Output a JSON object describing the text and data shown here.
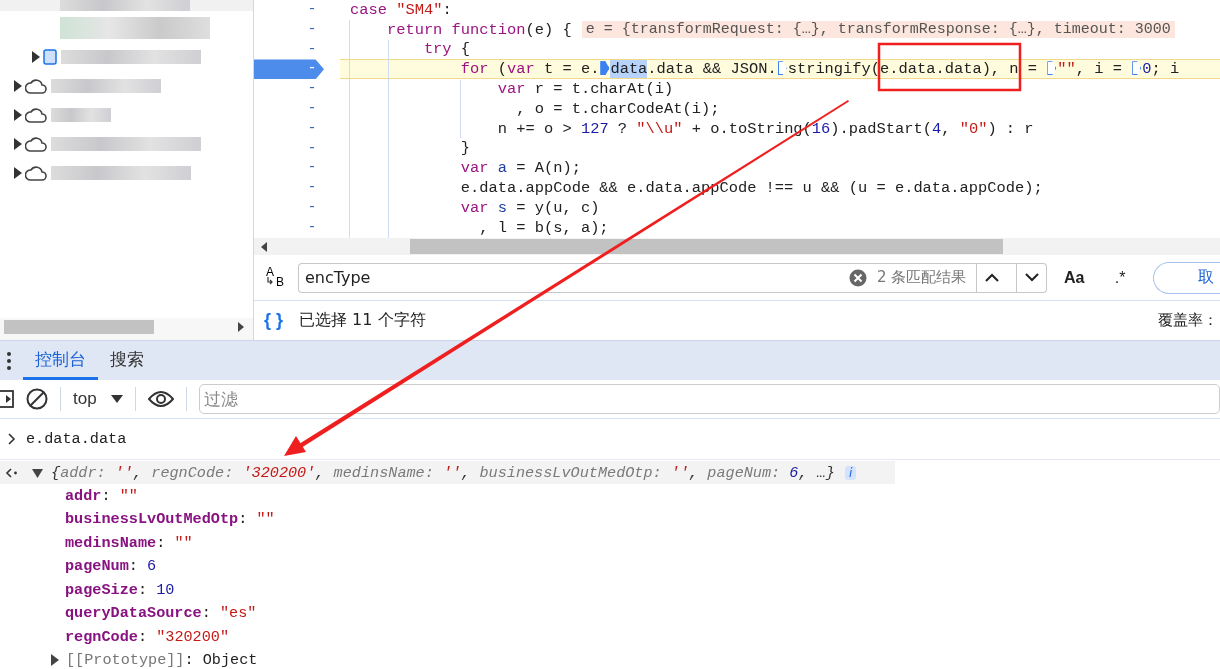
{
  "file_tree": {
    "items": [
      {
        "kind": "file",
        "expanded": false
      },
      {
        "kind": "cloud",
        "expanded": false
      },
      {
        "kind": "cloud",
        "expanded": false
      },
      {
        "kind": "cloud",
        "expanded": false
      },
      {
        "kind": "cloud",
        "expanded": false
      }
    ]
  },
  "editor": {
    "lines": [
      {
        "gutter": "-",
        "paused": false,
        "segments": [
          {
            "text": "case",
            "kind": "keyword"
          },
          {
            "text": " \"SM4\"",
            "kind": "string"
          },
          {
            "text": ":",
            "kind": "plain"
          }
        ]
      },
      {
        "gutter": "-",
        "paused": false,
        "segments": [
          {
            "text": "    return",
            "kind": "keyword"
          },
          {
            "text": " function",
            "kind": "keyword"
          },
          {
            "text": "(e) {",
            "kind": "plain"
          }
        ],
        "inline_value": "e = {transformRequest: {…}, transformResponse: {…}, timeout: 3000"
      },
      {
        "gutter": "-",
        "paused": false,
        "segments": [
          {
            "text": "        try",
            "kind": "keyword"
          },
          {
            "text": " {",
            "kind": "plain"
          }
        ]
      },
      {
        "gutter": "-",
        "paused": true,
        "segments": [
          {
            "text": "            for",
            "kind": "keyword"
          },
          {
            "text": " (",
            "kind": "plain"
          },
          {
            "text": "var",
            "kind": "keyword"
          },
          {
            "text": " t = e.",
            "kind": "plain"
          },
          {
            "kind": "marker",
            "active": true
          },
          {
            "text": "data",
            "kind": "selection"
          },
          {
            "text": ".data && JSON.",
            "kind": "plain"
          },
          {
            "kind": "marker",
            "active": false
          },
          {
            "text": "stringify(e.data.data), n = ",
            "kind": "plain"
          },
          {
            "kind": "marker",
            "active": false
          },
          {
            "text": "\"\"",
            "kind": "string"
          },
          {
            "text": ", i = ",
            "kind": "plain"
          },
          {
            "kind": "marker",
            "active": false
          },
          {
            "text": "0",
            "kind": "number"
          },
          {
            "text": "; i",
            "kind": "plain"
          }
        ]
      },
      {
        "gutter": "-",
        "paused": false,
        "segments": [
          {
            "text": "                var",
            "kind": "keyword"
          },
          {
            "text": " r = t.charAt(i)",
            "kind": "plain"
          }
        ]
      },
      {
        "gutter": "-",
        "paused": false,
        "segments": [
          {
            "text": "                  , o = t.charCodeAt(i);",
            "kind": "plain"
          }
        ]
      },
      {
        "gutter": "-",
        "paused": false,
        "segments": [
          {
            "text": "                n += o > ",
            "kind": "plain"
          },
          {
            "text": "127",
            "kind": "number"
          },
          {
            "text": " ? ",
            "kind": "plain"
          },
          {
            "text": "\"\\\\u\"",
            "kind": "string"
          },
          {
            "text": " + o.toString(",
            "kind": "plain"
          },
          {
            "text": "16",
            "kind": "number"
          },
          {
            "text": ").padStart(",
            "kind": "plain"
          },
          {
            "text": "4",
            "kind": "number"
          },
          {
            "text": ", ",
            "kind": "plain"
          },
          {
            "text": "\"0\"",
            "kind": "string"
          },
          {
            "text": ") : r",
            "kind": "plain"
          }
        ]
      },
      {
        "gutter": "-",
        "paused": false,
        "segments": [
          {
            "text": "            }",
            "kind": "plain"
          }
        ]
      },
      {
        "gutter": "-",
        "paused": false,
        "segments": [
          {
            "text": "            var",
            "kind": "keyword"
          },
          {
            "text": " a",
            "kind": "def"
          },
          {
            "text": " = A(n);",
            "kind": "plain"
          }
        ]
      },
      {
        "gutter": "-",
        "paused": false,
        "segments": [
          {
            "text": "            e.data.appCode && e.data.appCode !== u && (u = e.data.appCode);",
            "kind": "plain"
          }
        ]
      },
      {
        "gutter": "-",
        "paused": false,
        "segments": [
          {
            "text": "            var",
            "kind": "keyword"
          },
          {
            "text": " s",
            "kind": "def"
          },
          {
            "text": " = y(u, c)",
            "kind": "plain"
          }
        ]
      },
      {
        "gutter": "-",
        "paused": false,
        "segments": [
          {
            "text": "              , l = b(s, a);",
            "kind": "plain"
          }
        ]
      }
    ]
  },
  "search_bar": {
    "replace_toggle": "AB",
    "query": "encType",
    "match_count": "2 条匹配结果",
    "match_case": "Aa",
    "regex": ".*",
    "cancel": "取"
  },
  "status_bar": {
    "pretty_print": "{ }",
    "selection": "已选择 11 个字符",
    "coverage": "覆盖率："
  },
  "drawer": {
    "tabs": [
      {
        "label": "控制台",
        "selected": true
      },
      {
        "label": "搜索",
        "selected": false
      }
    ]
  },
  "console": {
    "context": "top",
    "filter_placeholder": "过滤",
    "input": "e.data.data",
    "result": {
      "expanded": true,
      "preview": [
        {
          "text": "{",
          "kind": "plain"
        },
        {
          "text": "addr: ",
          "kind": "key"
        },
        {
          "text": "''",
          "kind": "string"
        },
        {
          "text": ", ",
          "kind": "plain"
        },
        {
          "text": "regnCode: ",
          "kind": "key"
        },
        {
          "text": "'320200'",
          "kind": "string"
        },
        {
          "text": ", ",
          "kind": "plain"
        },
        {
          "text": "medinsName: ",
          "kind": "key"
        },
        {
          "text": "''",
          "kind": "string"
        },
        {
          "text": ", ",
          "kind": "plain"
        },
        {
          "text": "businessLvOutMedOtp: ",
          "kind": "key"
        },
        {
          "text": "''",
          "kind": "string"
        },
        {
          "text": ", ",
          "kind": "plain"
        },
        {
          "text": "pageNum: ",
          "kind": "key"
        },
        {
          "text": "6",
          "kind": "number"
        },
        {
          "text": ", …}",
          "kind": "plain"
        }
      ],
      "info_badge": "i",
      "properties": [
        {
          "key": "addr",
          "separator": ":",
          "value": "\"\"",
          "kind": "string"
        },
        {
          "key": "businessLvOutMedOtp",
          "separator": ":",
          "value": "\"\"",
          "kind": "string"
        },
        {
          "key": "medinsName",
          "separator": ":",
          "value": "\"\"",
          "kind": "string"
        },
        {
          "key": "pageNum",
          "separator": ":",
          "value": "6",
          "kind": "number"
        },
        {
          "key": "pageSize",
          "separator": ":",
          "value": "10",
          "kind": "number"
        },
        {
          "key": "queryDataSource",
          "separator": ":",
          "value": "\"es\"",
          "kind": "string"
        },
        {
          "key": "regnCode",
          "separator": ":",
          "value": "\"320200\"",
          "kind": "string"
        }
      ],
      "prototype": {
        "key": "[[Prototype]]",
        "separator": ":",
        "value": "Object",
        "expanded": false
      }
    }
  }
}
